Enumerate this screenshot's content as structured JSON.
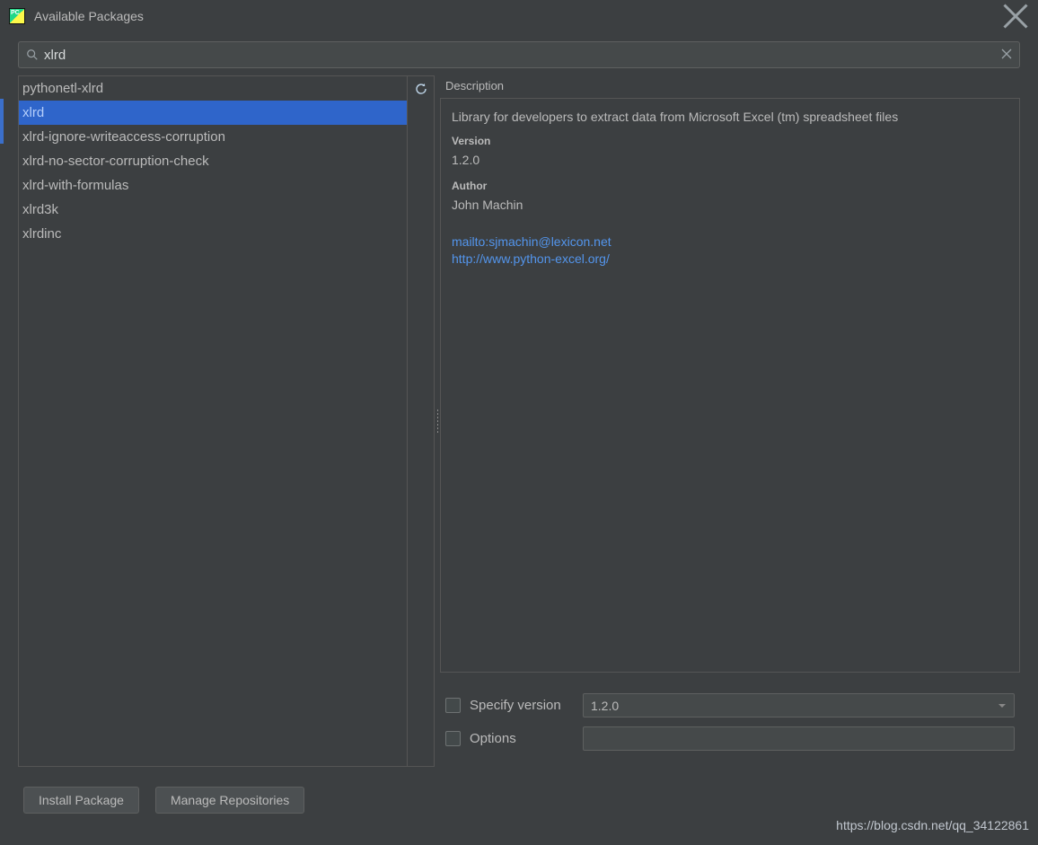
{
  "window": {
    "title": "Available Packages"
  },
  "search": {
    "value": "xlrd"
  },
  "packages": [
    "pythonetl-xlrd",
    "xlrd",
    "xlrd-ignore-writeaccess-corruption",
    "xlrd-no-sector-corruption-check",
    "xlrd-with-formulas",
    "xlrd3k",
    "xlrdinc"
  ],
  "selected_index": 1,
  "detail": {
    "section_title": "Description",
    "description": "Library for developers to extract data from Microsoft Excel (tm) spreadsheet files",
    "version_label": "Version",
    "version": "1.2.0",
    "author_label": "Author",
    "author": "John Machin",
    "links": [
      "mailto:sjmachin@lexicon.net",
      "http://www.python-excel.org/"
    ]
  },
  "controls": {
    "specify_version_label": "Specify version",
    "specify_version_value": "1.2.0",
    "options_label": "Options",
    "options_value": ""
  },
  "buttons": {
    "install": "Install Package",
    "manage": "Manage Repositories"
  },
  "watermark": "https://blog.csdn.net/qq_34122861"
}
